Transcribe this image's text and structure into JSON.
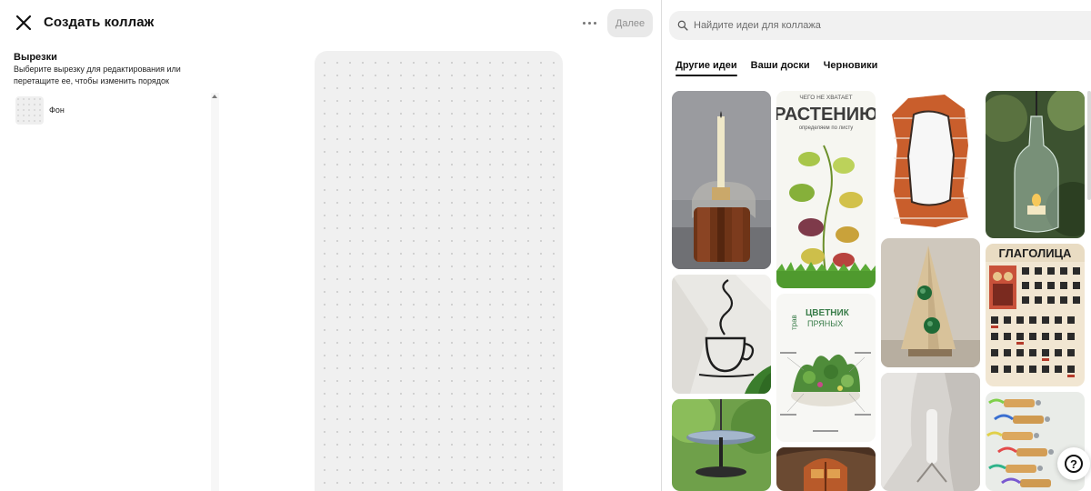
{
  "header": {
    "title": "Создать коллаж",
    "next_label": "Далее"
  },
  "cuts": {
    "title": "Вырезки",
    "description": "Выберите вырезку для редактирования или перетащите ее, чтобы изменить порядок",
    "items": [
      {
        "label": "Фон"
      }
    ]
  },
  "search": {
    "placeholder": "Найдите идеи для коллажа",
    "value": ""
  },
  "tabs": [
    {
      "label": "Другие идеи",
      "active": true
    },
    {
      "label": "Ваши доски",
      "active": false
    },
    {
      "label": "Черновики",
      "active": false
    }
  ],
  "pins": [
    {
      "name": "pin-candle-holder",
      "text": []
    },
    {
      "name": "pin-plant-leaves-poster",
      "text": [
        "ЧЕГО НЕ ХВАТАЕТ",
        "РАСТЕНИЮ",
        "определяем по листу"
      ]
    },
    {
      "name": "pin-brick-wall-mirror",
      "text": []
    },
    {
      "name": "pin-bottle-lantern",
      "text": []
    },
    {
      "name": "pin-wire-cup-art",
      "text": []
    },
    {
      "name": "pin-herb-garden-poster",
      "text": [
        "трав",
        "ЦВЕТНИК",
        "ПРЯНЫХ"
      ]
    },
    {
      "name": "pin-wooden-tree-decor",
      "text": []
    },
    {
      "name": "pin-glagolitsa-poster",
      "text": [
        "ГЛАГОЛИЦА"
      ]
    },
    {
      "name": "pin-bird-feeder",
      "text": []
    },
    {
      "name": "pin-fairy-door",
      "text": []
    },
    {
      "name": "pin-white-sculpture",
      "text": []
    },
    {
      "name": "pin-cork-keychains",
      "text": []
    }
  ],
  "help": {
    "label": "?"
  },
  "icons": {
    "close": "close-icon",
    "more": "more-dots-icon",
    "search": "search-icon",
    "help": "help-icon"
  }
}
